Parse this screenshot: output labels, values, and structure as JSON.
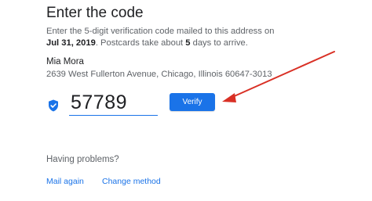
{
  "page": {
    "title": "Enter the code"
  },
  "instructions": {
    "part1": "Enter the 5-digit verification code mailed to this address on ",
    "date": "Jul 31, 2019",
    "part2": ". Postcards take about ",
    "days": "5",
    "part3": " days to arrive."
  },
  "recipient": {
    "name": "Mia Mora",
    "address": "2639 West Fullerton Avenue, Chicago, Illinois 60647-3013"
  },
  "code_input": {
    "value": "57789",
    "icon": "verified-shield-icon"
  },
  "verify_button": {
    "label": "Verify"
  },
  "help": {
    "heading": "Having problems?",
    "links": [
      {
        "label": "Mail again"
      },
      {
        "label": "Change method"
      }
    ]
  },
  "colors": {
    "accent": "#1a73e8",
    "annotation_arrow": "#d93025"
  }
}
